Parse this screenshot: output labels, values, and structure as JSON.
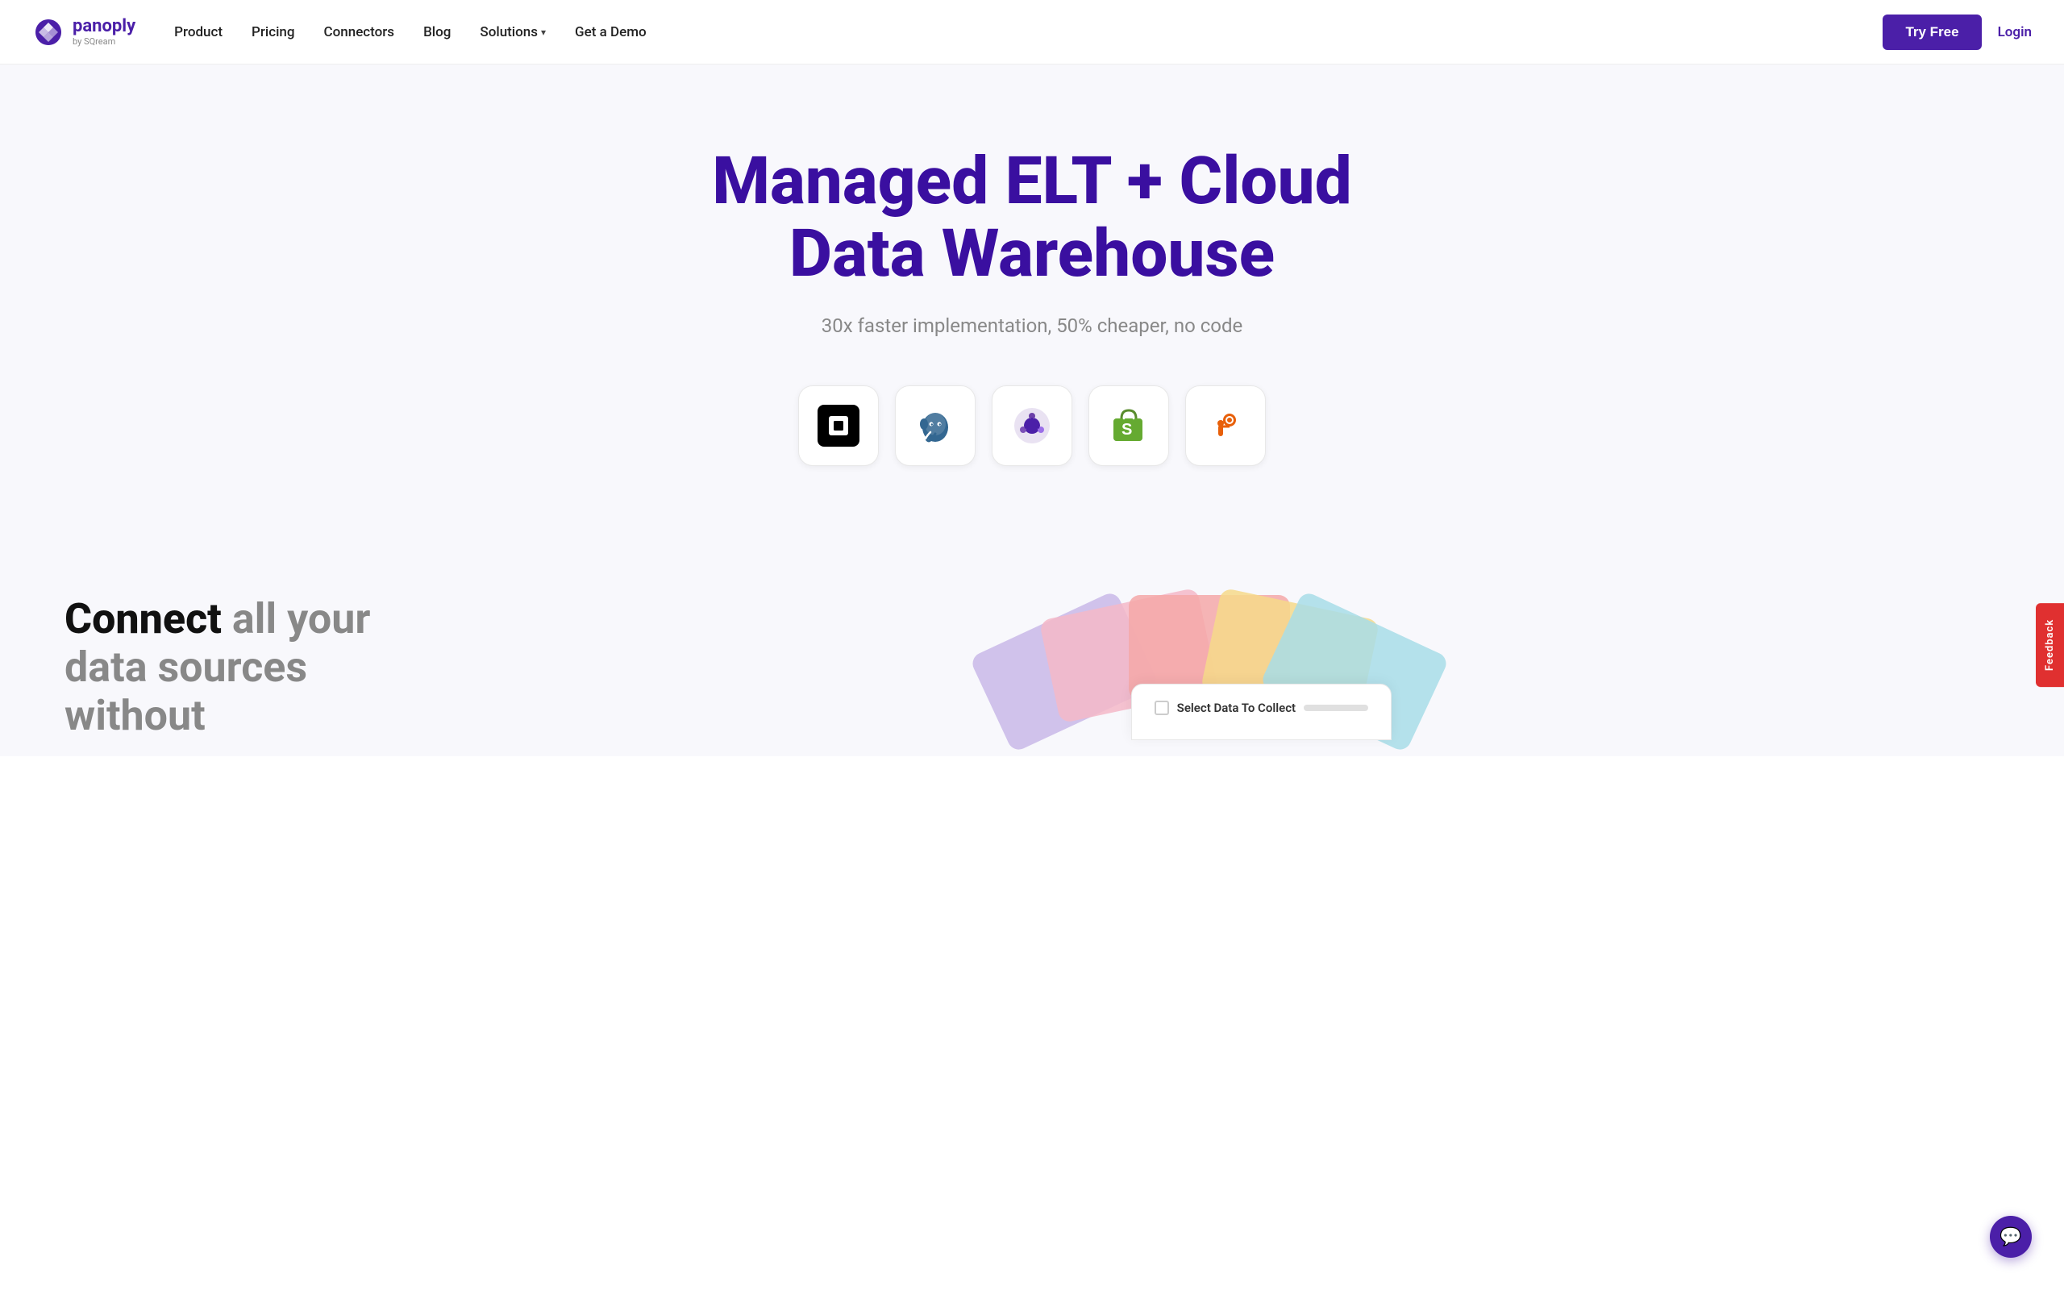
{
  "nav": {
    "logo": {
      "name": "panoply",
      "sub": "by SQream"
    },
    "links": [
      {
        "label": "Product",
        "id": "product"
      },
      {
        "label": "Pricing",
        "id": "pricing"
      },
      {
        "label": "Connectors",
        "id": "connectors"
      },
      {
        "label": "Blog",
        "id": "blog"
      },
      {
        "label": "Solutions",
        "id": "solutions",
        "hasDropdown": true
      },
      {
        "label": "Get a Demo",
        "id": "get-a-demo"
      }
    ],
    "cta": "Try Free",
    "login": "Login"
  },
  "hero": {
    "title": "Managed ELT + Cloud Data Warehouse",
    "subtitle": "30x faster implementation, 50% cheaper, no code"
  },
  "connectors": [
    {
      "id": "square",
      "label": "Square"
    },
    {
      "id": "postgresql",
      "label": "PostgreSQL"
    },
    {
      "id": "panoply-connector",
      "label": "Panoply Connector"
    },
    {
      "id": "shopify",
      "label": "Shopify"
    },
    {
      "id": "hubspot",
      "label": "HubSpot"
    }
  ],
  "connect_section": {
    "title_bold": "Connect",
    "title_gray": " all your\ndata sources\nwithout"
  },
  "data_panel": {
    "title": "Select Data To Collect"
  },
  "feedback": {
    "label": "Feedback"
  }
}
